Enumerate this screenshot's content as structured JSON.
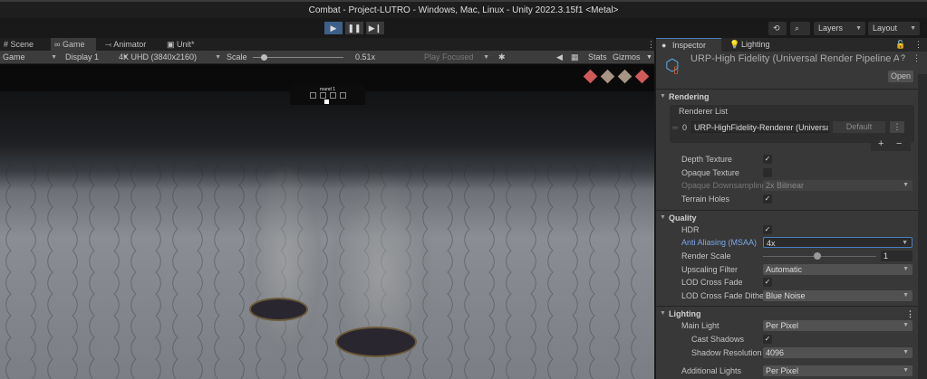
{
  "window": {
    "title": "Combat - Project-LUTRO - Windows, Mac, Linux - Unity 2022.3.15f1 <Metal>"
  },
  "toolbar": {
    "play": "▶",
    "pause": "❚❚",
    "step": "▶❙",
    "history_icon": "⟲",
    "search_icon": "⌕",
    "layers": "Layers",
    "layout": "Layout"
  },
  "tabs": [
    {
      "label": "Scene",
      "icon": "#"
    },
    {
      "label": "Game",
      "icon": "∞"
    },
    {
      "label": "Animator",
      "icon": "⤙"
    },
    {
      "label": "Unit*",
      "icon": "▣"
    }
  ],
  "gamebar": {
    "mode": "Game",
    "display": "Display 1",
    "resolution": "4K UHD (3840x2160)",
    "scale_label": "Scale",
    "scale_value": "0.51x",
    "scale_fraction": 0.1,
    "play_focused": "Play Focused",
    "stats": "Stats",
    "gizmos": "Gizmos"
  },
  "game": {
    "round_label": "round 1",
    "diamond_colors": [
      "#d05a5a",
      "#a89484",
      "#a89484",
      "#d05a5a"
    ]
  },
  "inspector": {
    "tabs": [
      {
        "label": "Inspector"
      },
      {
        "label": "Lighting"
      }
    ],
    "asset_title": "URP-High Fidelity (Universal Render Pipeline Asset)",
    "open_button": "Open",
    "rendering": {
      "title": "Rendering",
      "renderer_list_label": "Renderer List",
      "renderer_index": "0",
      "renderer_name": "URP-HighFidelity-Renderer (Universal Renderer Data)",
      "default_button": "Default",
      "add": "+",
      "remove": "−",
      "depth_texture": "Depth Texture",
      "opaque_texture": "Opaque Texture",
      "opaque_downsampling": "Opaque Downsampling",
      "opaque_downsampling_value": "2x Bilinear",
      "terrain_holes": "Terrain Holes"
    },
    "quality": {
      "title": "Quality",
      "hdr": "HDR",
      "anti_aliasing": "Anti Aliasing (MSAA)",
      "anti_aliasing_value": "4x",
      "render_scale": "Render Scale",
      "render_scale_value": "1",
      "upscaling_filter": "Upscaling Filter",
      "upscaling_filter_value": "Automatic",
      "lod_cross_fade": "LOD Cross Fade",
      "lod_cross_fade_dither": "LOD Cross Fade Dither",
      "lod_cross_fade_dither_value": "Blue Noise"
    },
    "lighting": {
      "title": "Lighting",
      "main_light": "Main Light",
      "main_light_value": "Per Pixel",
      "cast_shadows": "Cast Shadows",
      "shadow_resolution": "Shadow Resolution",
      "shadow_resolution_value": "4096",
      "additional_lights": "Additional Lights",
      "additional_lights_value": "Per Pixel"
    }
  }
}
